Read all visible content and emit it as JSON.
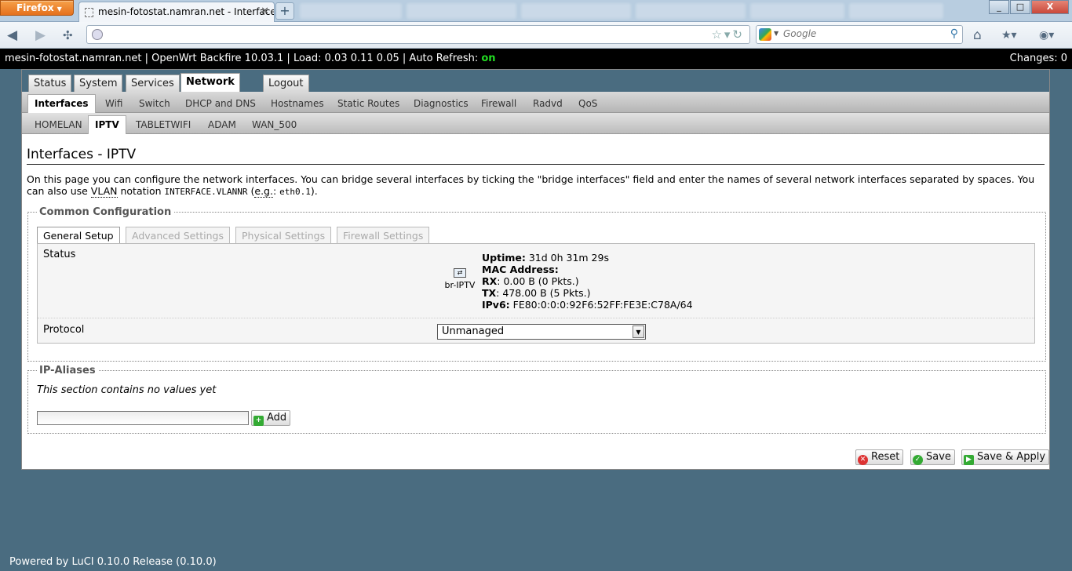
{
  "browser": {
    "menu_label": "Firefox",
    "tab_title": "mesin-fotostat.namran.net - Interfaces -...",
    "search_placeholder": "Google",
    "window_buttons": [
      "_",
      "□",
      "X"
    ]
  },
  "header": {
    "hostname": "mesin-fotostat.namran.net",
    "sep1": " | ",
    "distro": "OpenWrt Backfire 10.03.1",
    "sep2": " | ",
    "load": "Load: 0.03 0.11 0.05",
    "sep3": " | ",
    "auto_refresh_label": "Auto Refresh: ",
    "auto_refresh_value": "on",
    "changes": "Changes: 0"
  },
  "menu": {
    "top": [
      {
        "label": "Status"
      },
      {
        "label": "System"
      },
      {
        "label": "Services"
      },
      {
        "label": "Network"
      },
      {
        "label": "Logout"
      }
    ],
    "network": [
      {
        "label": "Interfaces"
      },
      {
        "label": "Wifi"
      },
      {
        "label": "Switch"
      },
      {
        "label": "DHCP and DNS"
      },
      {
        "label": "Hostnames"
      },
      {
        "label": "Static Routes"
      },
      {
        "label": "Diagnostics"
      },
      {
        "label": "Firewall"
      },
      {
        "label": "Radvd"
      },
      {
        "label": "QoS"
      }
    ],
    "interfaces": [
      {
        "label": "HOMELAN"
      },
      {
        "label": "IPTV"
      },
      {
        "label": "TABLETWIFI"
      },
      {
        "label": "ADAM"
      },
      {
        "label": "WAN_500"
      }
    ]
  },
  "page": {
    "title": "Interfaces - IPTV",
    "desc_part1": "On this page you can configure the network interfaces. You can bridge several interfaces by ticking the \"bridge interfaces\" field and enter the names of several network interfaces separated by spaces. You can also use ",
    "desc_vlan": "VLAN",
    "desc_part2": " notation ",
    "desc_code1": "INTERFACE.VLANNR",
    "desc_part3": " (",
    "desc_eg": "e.g.",
    "desc_part4": ": ",
    "desc_code2": "eth0.1",
    "desc_part5": ")."
  },
  "common": {
    "legend": "Common Configuration",
    "tabs": [
      "General Setup",
      "Advanced Settings",
      "Physical Settings",
      "Firewall Settings"
    ],
    "status_label": "Status",
    "iface_name": "br-IPTV",
    "uptime_label": "Uptime:",
    "uptime_value": " 31d 0h 31m 29s",
    "mac_label": "MAC Address:",
    "rx_label": "RX",
    "rx_value": ": 0.00 B (0 Pkts.)",
    "tx_label": "TX",
    "tx_value": ": 478.00 B (5 Pkts.)",
    "ipv6_label": "IPv6:",
    "ipv6_value": " FE80:0:0:0:92F6:52FF:FE3E:C78A/64",
    "protocol_label": "Protocol",
    "protocol_value": "Unmanaged"
  },
  "aliases": {
    "legend": "IP-Aliases",
    "empty_text": "This section contains no values yet",
    "add_label": "Add"
  },
  "actions": {
    "reset": "Reset",
    "save": "Save",
    "save_apply": "Save & Apply"
  },
  "footer": "Powered by LuCI 0.10.0 Release (0.10.0)"
}
